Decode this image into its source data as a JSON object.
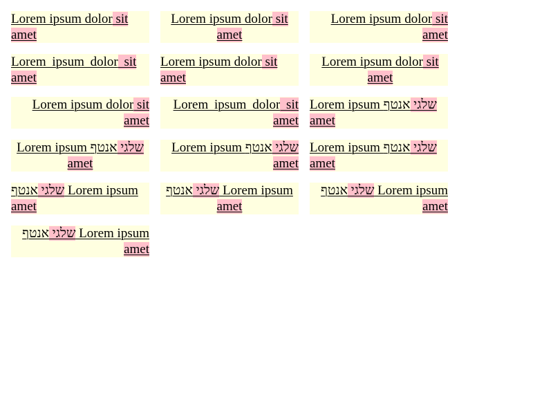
{
  "latin": {
    "lead": "Lorem ipsum dolor",
    "hl": " sit ",
    "hl2": "amet"
  },
  "mixed": {
    "lead": "Lorem ipsum ",
    "hebrew_a": "אנטף",
    "hebrew_b": " שלגי ",
    "tail": "amet"
  },
  "rtl": {
    "hebrew_b": "שלגי ",
    "hebrew_a": "אנטף",
    "lead": " Lorem ipsum",
    "tail": "amet"
  },
  "colors": {
    "box_background": "#ffffe0",
    "highlight": "#ffc0cb",
    "text": "#000000"
  }
}
